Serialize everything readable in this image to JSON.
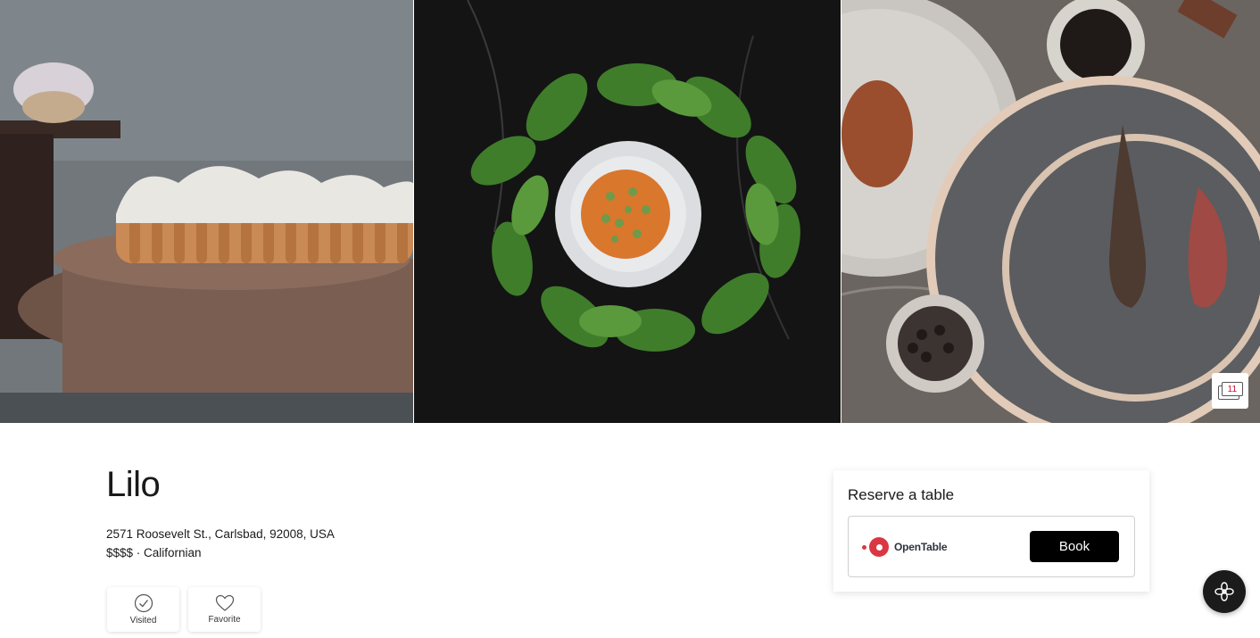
{
  "gallery": {
    "photo_count": "11",
    "photos": [
      "photo-1",
      "photo-2",
      "photo-3"
    ]
  },
  "restaurant": {
    "name": "Lilo",
    "address": "2571 Roosevelt St., Carlsbad, 92008, USA",
    "meta": "$$$$ · Californian"
  },
  "actions": {
    "visited_label": "Visited",
    "favorite_label": "Favorite"
  },
  "reservation": {
    "title": "Reserve a table",
    "provider": "OpenTable",
    "book_label": "Book"
  },
  "colors": {
    "opentable_red": "#da3743",
    "button_black": "#000000",
    "accent_red": "#c8102e"
  },
  "icons": {
    "visited": "check-circle-icon",
    "favorite": "heart-icon",
    "gallery": "photo-stack-icon",
    "fab": "flower-icon"
  }
}
